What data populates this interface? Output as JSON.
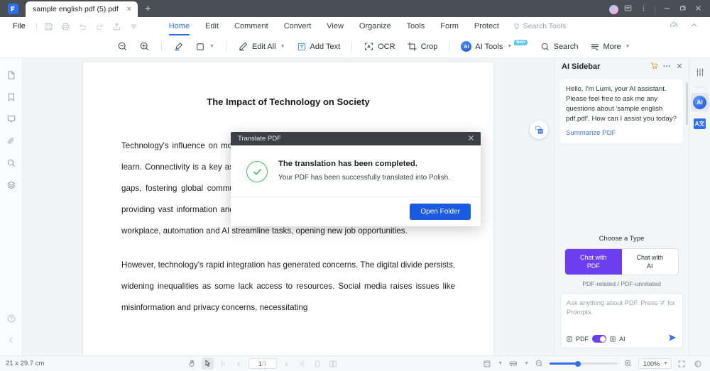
{
  "titlebar": {
    "tab_label": "sample english pdf (5).pdf",
    "close_label": "×",
    "new_tab_label": "+",
    "icons": [
      "avatar",
      "feedback-icon",
      "more-icon",
      "minimize-icon",
      "maximize-icon",
      "close-icon"
    ]
  },
  "menubar": {
    "file_label": "File",
    "quick_icons": [
      "save-icon",
      "print-icon",
      "undo-icon",
      "redo-icon",
      "share-icon",
      "customize-icon"
    ],
    "tabs": [
      {
        "label": "Home",
        "active": true
      },
      {
        "label": "Edit",
        "active": false
      },
      {
        "label": "Comment",
        "active": false
      },
      {
        "label": "Convert",
        "active": false
      },
      {
        "label": "View",
        "active": false
      },
      {
        "label": "Organize",
        "active": false
      },
      {
        "label": "Tools",
        "active": false
      },
      {
        "label": "Form",
        "active": false
      },
      {
        "label": "Protect",
        "active": false
      }
    ],
    "search_tools_label": "Search Tools",
    "right_icons": [
      "cloud-icon",
      "collapse-ribbon-icon"
    ]
  },
  "toolbar": {
    "items": [
      {
        "label": "",
        "icon": "zoom-out-icon",
        "caret": false
      },
      {
        "label": "",
        "icon": "zoom-in-icon",
        "caret": false
      },
      {
        "label": "",
        "icon": "highlighter-icon",
        "caret": false
      },
      {
        "label": "",
        "icon": "shape-icon",
        "caret": true
      },
      {
        "label": "Edit All",
        "icon": "edit-all-icon",
        "caret": true
      },
      {
        "label": "Add Text",
        "icon": "add-text-icon",
        "caret": false
      },
      {
        "label": "OCR",
        "icon": "ocr-icon",
        "caret": false
      },
      {
        "label": "Crop",
        "icon": "crop-icon",
        "caret": false
      },
      {
        "label": "AI Tools",
        "icon": "ai-tools-icon",
        "caret": true,
        "badge": "New"
      },
      {
        "label": "Search",
        "icon": "search-icon",
        "caret": false
      },
      {
        "label": "More",
        "icon": "more-icon",
        "caret": true
      }
    ]
  },
  "left_rail": {
    "icons": [
      "page-thumbnail-icon",
      "bookmark-icon",
      "comment-icon",
      "attachment-icon",
      "search-icon",
      "layers-icon",
      "help-icon",
      "collapse-left-icon"
    ]
  },
  "document": {
    "title": "The Impact of Technology on Society",
    "paragraphs": [
      "Technology's influence on modern society is profound, reshaping how we live, work, and learn. Connectivity is a key aspect, as the internet and smartphones bridges geographical gaps, fostering global communication. Education has transformed, with digital platforms providing vast information and empowering remote learning and skill development. In the workplace, automation and AI streamline tasks, opening new job opportunities.",
      "However, technology's rapid integration has generated concerns. The digital divide persists, widening inequalities as some lack access to resources. Social media raises issues like misinformation and privacy concerns, necessitating"
    ],
    "floating_button": "convert-to-word-icon"
  },
  "modal": {
    "title": "Translate PDF",
    "close_label": "×",
    "heading": "The translation has been completed.",
    "subtext": "Your PDF has been successfully translated into Polish.",
    "primary_button": "Open Folder",
    "status_icon": "success-check-icon"
  },
  "sidebar": {
    "title": "AI Sidebar",
    "header_icons": [
      "cart-icon",
      "more-icon",
      "close-icon"
    ],
    "greeting": "Hello, I'm Lumi, your AI assistant. Please feel free to ask me any questions about 'sample english pdf.pdf'. How can I assist you today?",
    "action_link": "Summarize PDF",
    "choose_type_label": "Choose a Type",
    "type_options": [
      {
        "label_line1": "Chat with",
        "label_line2": "PDF",
        "active": true
      },
      {
        "label_line1": "Chat with",
        "label_line2": "AI",
        "active": false
      }
    ],
    "type_note": "PDF-related / PDF-unrelated",
    "composer_placeholder": "Ask anything about PDF. Press '#' for Prompts.",
    "composer_left_label": "PDF",
    "composer_right_label": "AI",
    "send_icon": "send-icon"
  },
  "right_rail": {
    "icons": [
      "sliders-icon",
      "ai-assistant-icon",
      "translate-icon"
    ],
    "ai_label": "AI",
    "translate_label": "A文"
  },
  "statusbar": {
    "page_size": "21 x 29.7 cm",
    "tool_icons": [
      "hand-tool-icon",
      "select-tool-icon"
    ],
    "nav_first": "|‹",
    "nav_prev": "‹",
    "page_current": "1",
    "page_total": "/1",
    "nav_next": "›",
    "nav_last": "›|",
    "view_single_icon": "single-page-icon",
    "view_facing_icon": "facing-page-icon",
    "layout_icon": "page-layout-icon",
    "scroll_icon": "scroll-mode-icon",
    "zoom_out_icon": "zoom-out-icon",
    "zoom_in_icon": "zoom-in-icon",
    "zoom_level": "100%",
    "fit_icon": "fit-page-icon",
    "theme_icon": "theme-icon"
  },
  "colors": {
    "accent_blue": "#2d6df6",
    "accent_purple": "#6b3ff0",
    "success_green": "#3bbf5e",
    "titlebar_bg": "#4a4f55",
    "modal_head_bg": "#3b4047"
  }
}
